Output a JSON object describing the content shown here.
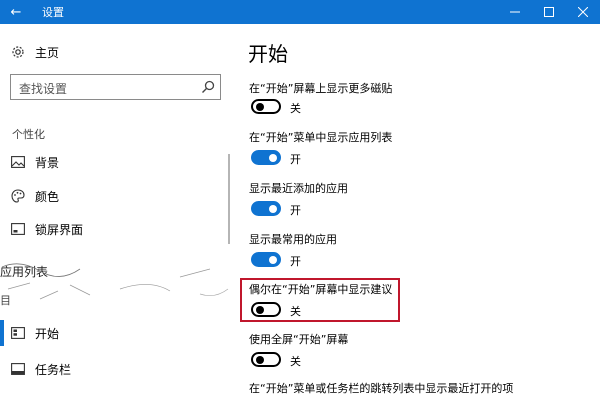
{
  "window": {
    "title": "设置",
    "back_glyph": "←",
    "minimize_glyph": "—",
    "maximize_glyph": "☐",
    "close_glyph": "✕"
  },
  "sidebar": {
    "home_label": "主页",
    "search_placeholder": "查找设置",
    "section_title": "个性化",
    "items": [
      {
        "label": "背景",
        "icon": "image-icon"
      },
      {
        "label": "颜色",
        "icon": "palette-icon"
      },
      {
        "label": "锁屏界面",
        "icon": "lock-screen-icon"
      },
      {
        "label": "开始",
        "icon": "start-icon"
      },
      {
        "label": "任务栏",
        "icon": "taskbar-icon"
      }
    ],
    "tooltip_text": "应用列表",
    "partial_section": "目"
  },
  "main": {
    "title": "开始",
    "settings": [
      {
        "label": "在“开始”屏幕上显示更多磁贴",
        "state": "关",
        "on": false
      },
      {
        "label": "在“开始”菜单中显示应用列表",
        "state": "开",
        "on": true
      },
      {
        "label": "显示最近添加的应用",
        "state": "开",
        "on": true
      },
      {
        "label": "显示最常用的应用",
        "state": "开",
        "on": true
      },
      {
        "label": "偶尔在“开始”屏幕中显示建议",
        "state": "关",
        "on": false
      },
      {
        "label": "使用全屏“开始”屏幕",
        "state": "关",
        "on": false
      },
      {
        "label": "在“开始”菜单或任务栏的跳转列表中显示最近打开的项",
        "state": "",
        "on": false
      }
    ]
  },
  "colors": {
    "accent": "#0f73d1",
    "highlight": "#c0172c"
  }
}
